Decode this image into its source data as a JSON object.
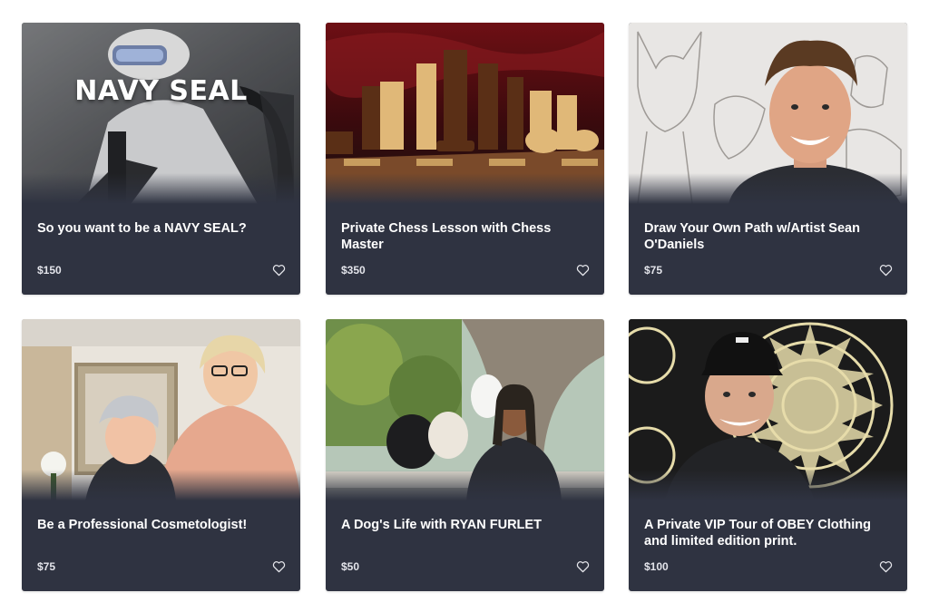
{
  "cards": [
    {
      "title": "So you want to be a NAVY SEAL?",
      "price": "$150",
      "image_text": "NAVY SEAL",
      "icon": "heart-outline-icon"
    },
    {
      "title": "Private Chess Lesson with Chess Master",
      "price": "$350",
      "icon": "heart-outline-icon"
    },
    {
      "title": "Draw Your Own Path w/Artist Sean O'Daniels",
      "price": "$75",
      "icon": "heart-outline-icon"
    },
    {
      "title": "Be a Professional Cosmetologist!",
      "price": "$75",
      "icon": "heart-outline-icon"
    },
    {
      "title": "A Dog's Life with RYAN FURLET",
      "price": "$50",
      "icon": "heart-outline-icon"
    },
    {
      "title": "A Private VIP Tour of OBEY Clothing and limited edition print.",
      "price": "$100",
      "icon": "heart-outline-icon"
    }
  ],
  "colors": {
    "card_background": "#2f3341",
    "title_text": "#ffffff",
    "price_text": "#e3e4ea"
  }
}
